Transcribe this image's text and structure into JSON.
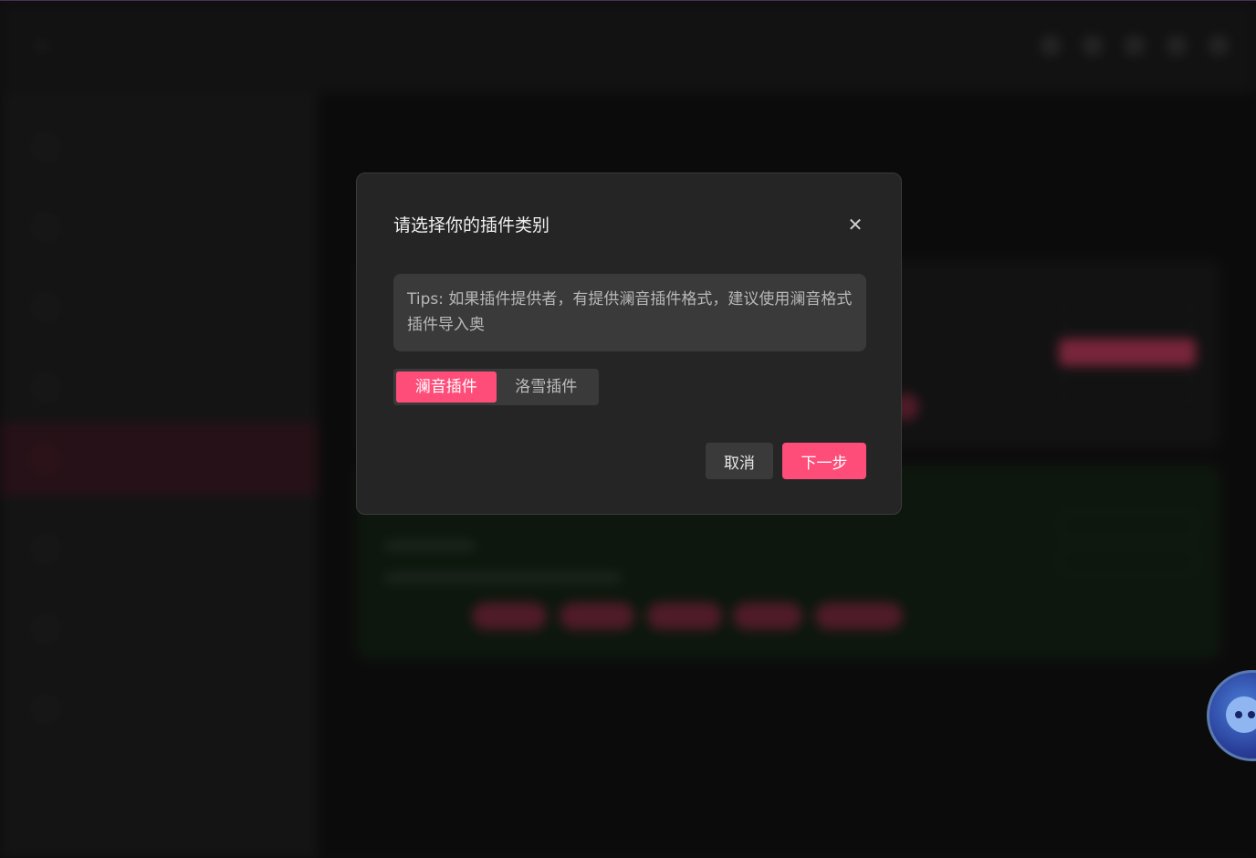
{
  "dialog": {
    "title": "请选择你的插件类别",
    "close_icon": "close-icon",
    "tips": "Tips: 如果插件提供者，有提供澜音插件格式，建议使用澜音格式插件导入奥",
    "plugin_types": [
      {
        "label": "澜音插件",
        "selected": true
      },
      {
        "label": "洛雪插件",
        "selected": false
      }
    ],
    "cancel_label": "取消",
    "next_label": "下一步"
  },
  "colors": {
    "accent": "#ff4d7a",
    "dialog_bg": "#252525",
    "tips_bg": "#3a3a3a"
  },
  "assistant": {
    "icon": "assistant-avatar-icon"
  }
}
